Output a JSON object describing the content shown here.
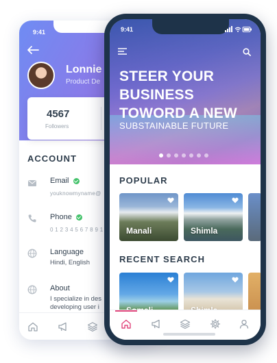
{
  "back_phone": {
    "status_time": "9:41",
    "profile": {
      "name": "Lonnie",
      "role": "Product De"
    },
    "stats": {
      "followers_count": "4567",
      "followers_label": "Followers"
    },
    "section_title": "ACCOUNT",
    "rows": {
      "email": {
        "title": "Email",
        "value": "youknowmyname@"
      },
      "phone": {
        "title": "Phone",
        "value": "0 1 2 3 4 5 6 7 8 9 1 0"
      },
      "language": {
        "title": "Language",
        "value": "Hindi, English"
      },
      "about": {
        "title": "About",
        "value": "I specialize in des",
        "value2": "developing user i"
      }
    }
  },
  "front_phone": {
    "status_time": "9:41",
    "hero": {
      "title_line1": "STEER YOUR",
      "title_line2": "BUSINESS",
      "title_line3": "TOWORD A NEW",
      "subtitle": "SUBSTAINABLE FUTURE",
      "slides": 7,
      "active_slide": 0
    },
    "popular": {
      "label": "POPULAR",
      "cards": [
        {
          "label": "Manali"
        },
        {
          "label": "Shimla"
        }
      ]
    },
    "recent": {
      "label": "RECENT SEARCH",
      "cards": [
        {
          "label": "Somali"
        },
        {
          "label": "Shimla"
        }
      ]
    }
  },
  "colors": {
    "accent": "#e0457b",
    "header_gradient_start": "#6f8cf3",
    "header_gradient_end": "#9b70e0",
    "phone_frame": "#1e3349",
    "check_green": "#44c26b"
  },
  "icons": [
    "back-arrow-icon",
    "mail-icon",
    "phone-icon",
    "globe-icon",
    "home-icon",
    "megaphone-icon",
    "layers-icon",
    "gear-icon",
    "user-icon",
    "menu-icon",
    "search-icon",
    "heart-icon"
  ]
}
